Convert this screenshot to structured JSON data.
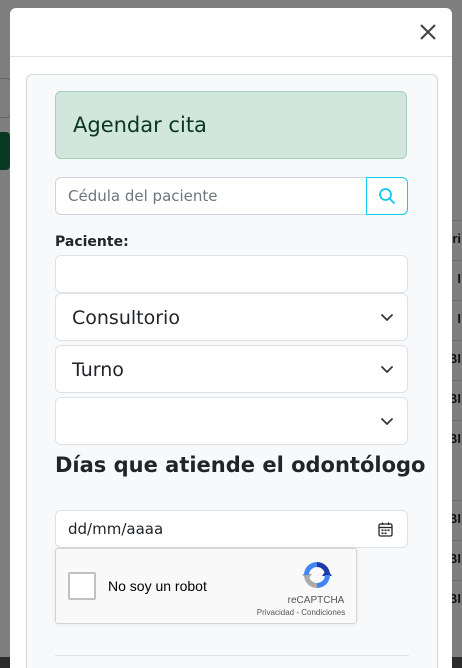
{
  "background": {
    "partial_table_text": [
      "ri",
      "I",
      "I",
      "BI",
      "BI",
      "BI",
      "BI",
      "BI",
      "BI"
    ]
  },
  "modal": {
    "close_icon": "close-icon",
    "alert": {
      "title": "Agendar cita",
      "color": "#d1e7dd"
    },
    "search": {
      "placeholder": "Cédula del paciente",
      "value": "",
      "button_icon": "search-icon",
      "accent": "#0dcaf0"
    },
    "patient": {
      "label": "Paciente:",
      "value": ""
    },
    "selects": {
      "consultorio": "Consultorio",
      "turno": "Turno",
      "tercero": ""
    },
    "section_title": "Días que atiende el odontólogo",
    "date": {
      "value": "dd/mm/aaaa",
      "icon": "calendar-icon"
    },
    "recaptcha": {
      "label": "No soy un robot",
      "brand": "reCAPTCHA",
      "privacy": "Privacidad",
      "separator": " - ",
      "terms": "Condiciones"
    }
  }
}
